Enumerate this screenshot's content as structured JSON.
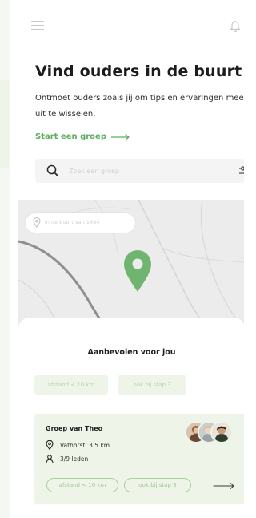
{
  "colors": {
    "accent": "#5fae5f",
    "pin": "#6fb56f",
    "chip_bg": "#eef5e8",
    "chip_outline": "#a9d19b",
    "map_bg": "#ececec"
  },
  "header": {
    "menu_icon": "hamburger-menu-icon",
    "notification_icon": "bell-icon"
  },
  "hero": {
    "title": "Vind ouders in de buurt",
    "intro": "Ontmoet ouders zoals jij om tips en ervaringen mee uit te wisselen.",
    "start_link": "Start een groep"
  },
  "search": {
    "placeholder": "Zoek een groep",
    "value": "",
    "filter_icon": "sliders-filter-icon"
  },
  "map": {
    "location_chip": "in de buurt van 1484",
    "pin_icon": "location-pin-icon"
  },
  "recommendations": {
    "title": "Aanbevolen voor jou",
    "filter_chips": [
      "afstand < 10 km",
      "ook bij stap 3"
    ]
  },
  "group_card": {
    "name": "Groep van Theo",
    "location": "Vathorst, 3.5 km",
    "members": "3/9 leden",
    "tags": [
      "afstand < 10 km",
      "ook bij stap 3"
    ],
    "arrow_icon": "arrow-right-icon"
  }
}
